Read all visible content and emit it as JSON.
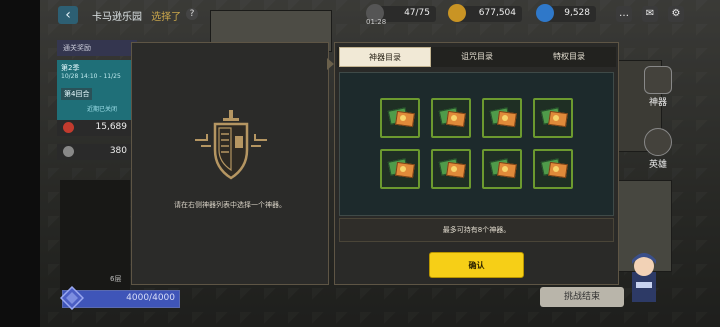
{
  "header": {
    "back_icon": "‹",
    "park_title": "卡马逊乐园",
    "park_subtitle": "选择了",
    "help_icon": "?",
    "resources": [
      {
        "name": "stamina",
        "value": "47/75",
        "add": "+"
      },
      {
        "name": "gold",
        "value": "677,504"
      },
      {
        "name": "gems",
        "value": "9,528",
        "add": "+"
      }
    ],
    "timer": "01:28"
  },
  "left_panel": {
    "header": "通关奖励",
    "round_label": "第2季",
    "round_dates": "10/28 14:10 - 11/25",
    "round_badge": "第4回合",
    "round_hint": "近期已关闭",
    "stats": [
      {
        "name": "attack",
        "value": "15,689",
        "color": "#c23b2e"
      },
      {
        "name": "defense",
        "value": "380",
        "color": "#888888"
      }
    ],
    "floor_label": "6层",
    "floor_number": "6"
  },
  "hp": {
    "text": "4000/4000",
    "fraction": 1.0
  },
  "side": {
    "artifact_label": "神器",
    "hero_label": "英雄",
    "end_battle": "挑战结束"
  },
  "modal": {
    "hint": "请在右侧神器列表中选择一个神器。",
    "tabs": [
      {
        "label": "神器目录",
        "active": true
      },
      {
        "label": "诅咒目录",
        "active": false
      },
      {
        "label": "特权目录",
        "active": false
      }
    ],
    "slot_count": 8,
    "limit_text": "最多可持有8个神器。",
    "confirm": "确认"
  }
}
